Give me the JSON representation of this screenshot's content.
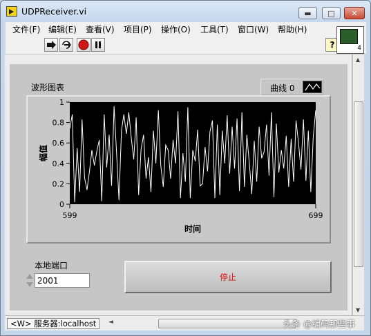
{
  "window": {
    "title": "UDPReceiver.vi",
    "minimize": "▬",
    "maximize": "□",
    "close": "✕"
  },
  "menu": [
    "文件(F)",
    "编辑(E)",
    "查看(V)",
    "项目(P)",
    "操作(O)",
    "工具(T)",
    "窗口(W)",
    "帮助(H)"
  ],
  "toolbar": {
    "help": "?",
    "icons": [
      "run-arrow-icon",
      "run-continuously-icon",
      "abort-icon",
      "pause-icon",
      "help-icon"
    ]
  },
  "vi_icon_number": "4",
  "graph": {
    "title": "波形图表",
    "legend_label": "曲线 0"
  },
  "chart_data": {
    "type": "line",
    "title": "",
    "xlabel": "时间",
    "ylabel": "幅值",
    "xlim": [
      599,
      699
    ],
    "ylim": [
      0,
      1
    ],
    "x_ticks": [
      "599",
      "699"
    ],
    "y_ticks": [
      "0",
      "0.2",
      "0.4",
      "0.6",
      "0.8",
      "1"
    ],
    "plot_background": "#000000",
    "series": [
      {
        "name": "曲线 0",
        "color": "#ffffff",
        "x_start": 599,
        "x_step": 1,
        "values": [
          0.74,
          0.88,
          0.02,
          0.55,
          0.12,
          0.83,
          0.26,
          0.14,
          0.32,
          0.53,
          0.38,
          0.52,
          0.63,
          0.03,
          0.88,
          0.36,
          0.68,
          0.18,
          0.96,
          0.52,
          0.04,
          0.72,
          0.88,
          0.69,
          0.9,
          0.65,
          0.44,
          0.85,
          0.09,
          0.54,
          0.68,
          0.25,
          0.46,
          0.12,
          0.72,
          0.4,
          0.92,
          0.38,
          0.17,
          0.58,
          0.53,
          0.25,
          0.63,
          0.4,
          0.91,
          0.06,
          0.5,
          0.22,
          0.95,
          0.06,
          0.53,
          0.42,
          0.73,
          0.18,
          0.2,
          0.56,
          0.32,
          0.71,
          0.82,
          0.06,
          0.78,
          0.09,
          0.72,
          0.4,
          0.87,
          0.3,
          0.76,
          0.35,
          0.84,
          0.13,
          0.9,
          0.17,
          0.68,
          0.4,
          0.1,
          0.62,
          0.22,
          0.76,
          0.45,
          0.51,
          0.78,
          0.28,
          0.9,
          0.07,
          0.79,
          0.31,
          0.53,
          0.35,
          0.67,
          0.17,
          0.64,
          0.22,
          0.82,
          0.6,
          0.34,
          0.83,
          0.23,
          0.72,
          0.12,
          0.66,
          0.92
        ]
      }
    ]
  },
  "port": {
    "label": "本地端口",
    "value": "2001"
  },
  "stop_button": {
    "label": "停止",
    "color": "#e01010"
  },
  "status": {
    "text": "<W> 服务器:localhost"
  },
  "watermark": "头条 @编码那些事"
}
